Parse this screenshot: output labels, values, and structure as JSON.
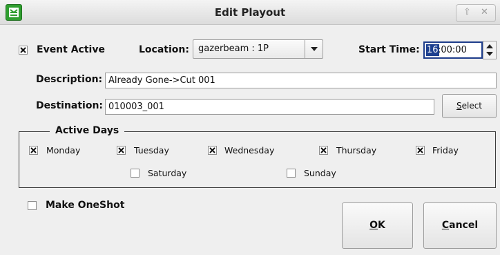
{
  "window": {
    "title": "Edit Playout",
    "icon": "rivendell-app-icon",
    "controls": [
      "pin-icon",
      "close-icon"
    ]
  },
  "event_active": {
    "label": "Event Active",
    "checked": true
  },
  "location": {
    "label": "Location:",
    "value": "gazerbeam : 1P"
  },
  "start_time": {
    "label": "Start Time:",
    "hours": "16",
    "rest": ":00:00"
  },
  "description": {
    "label": "Description:",
    "value": "Already Gone->Cut 001"
  },
  "destination": {
    "label": "Destination:",
    "value": "010003_001"
  },
  "select_button": {
    "mnemonic": "S",
    "rest": "elect"
  },
  "active_days": {
    "title": "Active Days",
    "days": [
      {
        "label": "Monday",
        "checked": true
      },
      {
        "label": "Tuesday",
        "checked": true
      },
      {
        "label": "Wednesday",
        "checked": true
      },
      {
        "label": "Thursday",
        "checked": true
      },
      {
        "label": "Friday",
        "checked": true
      },
      {
        "label": "Saturday",
        "checked": false
      },
      {
        "label": "Sunday",
        "checked": false
      }
    ]
  },
  "make_oneshot": {
    "label": "Make OneShot",
    "checked": false
  },
  "ok_button": {
    "mnemonic": "O",
    "rest": "K"
  },
  "cancel_button": {
    "mnemonic": "C",
    "rest": "ancel"
  }
}
